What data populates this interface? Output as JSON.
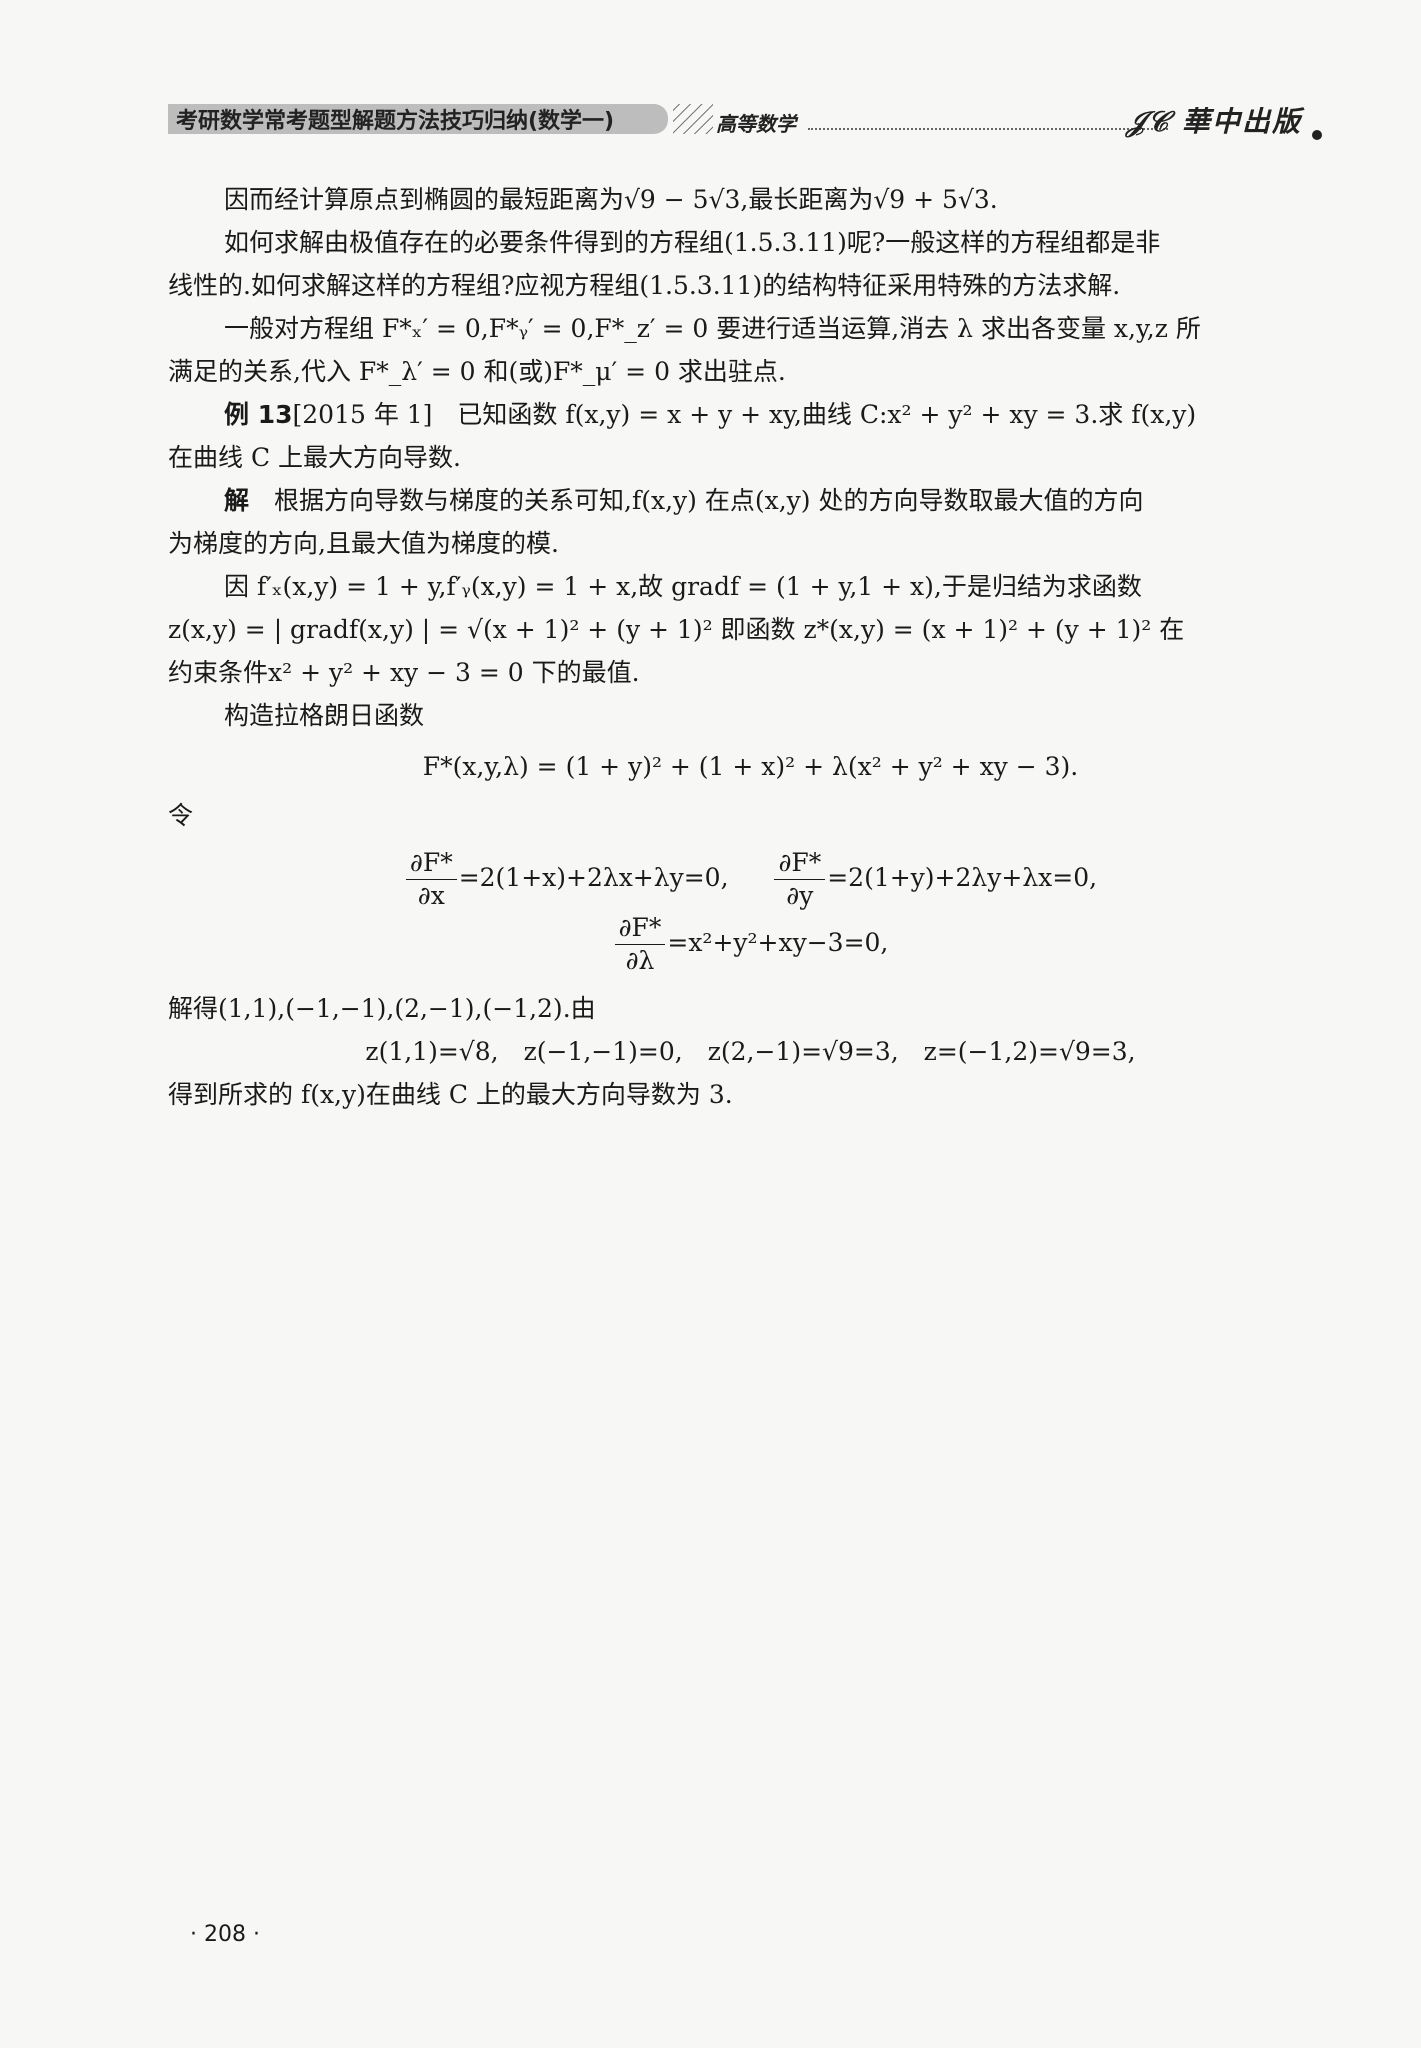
{
  "header": {
    "book_title": "考研数学常考题型解题方法技巧归纳(数学一)",
    "section": "高等数学",
    "publisher": "华中出版"
  },
  "lines": {
    "l1": "因而经计算原点到椭圆的最短距离为√9 − 5√3,最长距离为√9 + 5√3.",
    "l2": "如何求解由极值存在的必要条件得到的方程组(1.5.3.11)呢?一般这样的方程组都是非",
    "l3": "线性的.如何求解这样的方程组?应视方程组(1.5.3.11)的结构特征采用特殊的方法求解.",
    "l4": "一般对方程组 F*ₓ′ = 0,F*ᵧ′ = 0,F*_z′ = 0 要进行适当运算,消去 λ 求出各变量 x,y,z 所",
    "l5": "满足的关系,代入 F*_λ′ = 0 和(或)F*_μ′ = 0 求出驻点.",
    "l6_label": "例 13",
    "l6": "[2015 年 1]　已知函数 f(x,y) = x + y + xy,曲线 C:x² + y² + xy = 3.求 f(x,y)",
    "l7": "在曲线 C 上最大方向导数.",
    "l8_label": "解",
    "l8": "根据方向导数与梯度的关系可知,f(x,y) 在点(x,y) 处的方向导数取最大值的方向",
    "l9": "为梯度的方向,且最大值为梯度的模.",
    "l10": "因 f′ₓ(x,y) = 1 + y,f′ᵧ(x,y) = 1 + x,故 gradf = (1 + y,1 + x),于是归结为求函数",
    "l11": "z(x,y) = | gradf(x,y) | = √(x + 1)² + (y + 1)² 即函数 z*(x,y) = (x + 1)² + (y + 1)² 在",
    "l12": "约束条件x² + y² + xy − 3 = 0 下的最值.",
    "l13": "构造拉格朗日函数",
    "eq_lagrange": "F*(x,y,λ) = (1 + y)² + (1 + x)² + λ(x² + y² + xy − 3).",
    "l14": "令",
    "eq_a_num": "∂F*",
    "eq_a_den": "∂x",
    "eq_a_rhs": "=2(1+x)+2λx+λy=0,",
    "eq_b_num": "∂F*",
    "eq_b_den": "∂y",
    "eq_b_rhs": "=2(1+y)+2λy+λx=0,",
    "eq_c_num": "∂F*",
    "eq_c_den": "∂λ",
    "eq_c_rhs": "=x²+y²+xy−3=0,",
    "l15": "解得(1,1),(−1,−1),(2,−1),(−1,2).由",
    "eq_z": "z(1,1)=√8,　z(−1,−1)=0,　z(2,−1)=√9=3,　z=(−1,2)=√9=3,",
    "l16": "得到所求的 f(x,y)在曲线 C 上的最大方向导数为 3."
  },
  "page_number": "· 208 ·"
}
